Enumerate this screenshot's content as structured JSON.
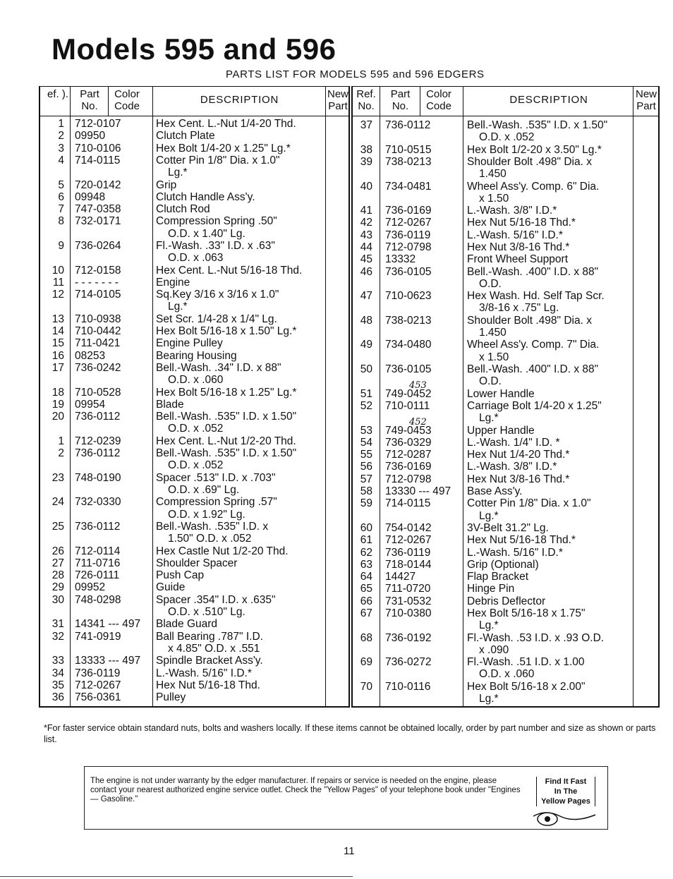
{
  "title": "Models 595 and 596",
  "subtitle": "PARTS LIST FOR MODELS 595 and 596 EDGERS",
  "headers": {
    "ref": "Ref. No.",
    "ref_left": "ef. ).",
    "part": "Part No.",
    "color": "Color Code",
    "description": "DESCRIPTION",
    "new_part": "New Part"
  },
  "left_table": [
    {
      "ref": "1",
      "part": "712-0107",
      "desc": [
        "Hex Cent. L.-Nut 1/4-20 Thd."
      ]
    },
    {
      "ref": "2",
      "part": "09950",
      "desc": [
        "Clutch Plate"
      ]
    },
    {
      "ref": "3",
      "part": "710-0106",
      "desc": [
        "Hex Bolt 1/4-20 x 1.25\" Lg.*"
      ]
    },
    {
      "ref": "4",
      "part": "714-0115",
      "desc": [
        "Cotter Pin 1/8\" Dia. x 1.0\"",
        "Lg.*"
      ]
    },
    {
      "ref": "5",
      "part": "720-0142",
      "desc": [
        "Grip"
      ]
    },
    {
      "ref": "6",
      "part": "09948",
      "desc": [
        "Clutch Handle Ass'y."
      ]
    },
    {
      "ref": "7",
      "part": "747-0358",
      "desc": [
        "Clutch Rod"
      ]
    },
    {
      "ref": "8",
      "part": "732-0171",
      "desc": [
        "Compression Spring .50\"",
        "O.D. x 1.40\" Lg."
      ]
    },
    {
      "ref": "9",
      "part": "736-0264",
      "desc": [
        "Fl.-Wash. .33\" I.D. x .63\"",
        "O.D. x .063"
      ]
    },
    {
      "ref": "10",
      "part": "712-0158",
      "desc": [
        "Hex Cent. L.-Nut 5/16-18 Thd."
      ]
    },
    {
      "ref": "11",
      "part": "- - - - - - -",
      "desc": [
        "Engine"
      ]
    },
    {
      "ref": "12",
      "part": "714-0105",
      "desc": [
        "Sq.Key 3/16 x 3/16 x 1.0\"",
        "Lg.*"
      ]
    },
    {
      "ref": "13",
      "part": "710-0938",
      "desc": [
        "Set Scr. 1/4-28 x 1/4\" Lg."
      ]
    },
    {
      "ref": "14",
      "part": "710-0442",
      "desc": [
        "Hex Bolt 5/16-18 x 1.50\" Lg.*"
      ]
    },
    {
      "ref": "15",
      "part": "711-0421",
      "desc": [
        "Engine Pulley"
      ]
    },
    {
      "ref": "16",
      "part": "08253",
      "desc": [
        "Bearing Housing"
      ]
    },
    {
      "ref": "17",
      "part": "736-0242",
      "desc": [
        "Bell.-Wash. .34\" I.D. x 88\"",
        "O.D. x .060"
      ]
    },
    {
      "ref": "18",
      "part": "710-0528",
      "desc": [
        "Hex Bolt 5/16-18 x 1.25\" Lg.*"
      ]
    },
    {
      "ref": "19",
      "part": "09954",
      "desc": [
        "Blade"
      ]
    },
    {
      "ref": "20",
      "part": "736-0112",
      "desc": [
        "Bell.-Wash. .535\" I.D. x 1.50\"",
        "O.D. x .052"
      ]
    },
    {
      "ref": "1",
      "part": "712-0239",
      "desc": [
        "Hex Cent. L.-Nut 1/2-20 Thd."
      ]
    },
    {
      "ref": "2",
      "part": "736-0112",
      "desc": [
        "Bell.-Wash. .535\" I.D. x 1.50\"",
        "O.D. x .052"
      ]
    },
    {
      "ref": "23",
      "part": "748-0190",
      "desc": [
        "Spacer .513\" I.D. x .703\"",
        "O.D. x .69\" Lg."
      ]
    },
    {
      "ref": "24",
      "part": "732-0330",
      "desc": [
        "Compression Spring .57\"",
        "O.D. x 1.92\" Lg."
      ]
    },
    {
      "ref": "25",
      "part": "736-0112",
      "desc": [
        "Bell.-Wash. .535\" I.D. x",
        "1.50\" O.D. x .052"
      ]
    },
    {
      "ref": "26",
      "part": "712-0114",
      "desc": [
        "Hex Castle Nut 1/2-20 Thd."
      ]
    },
    {
      "ref": "27",
      "part": "711-0716",
      "desc": [
        "Shoulder Spacer"
      ]
    },
    {
      "ref": "28",
      "part": "726-0111",
      "desc": [
        "Push Cap"
      ]
    },
    {
      "ref": "29",
      "part": "09952",
      "desc": [
        "Guide"
      ]
    },
    {
      "ref": "30",
      "part": "748-0298",
      "desc": [
        "Spacer .354\" I.D. x .635\"",
        "O.D. x .510\" Lg."
      ]
    },
    {
      "ref": "31",
      "part": "14341 --- 497",
      "desc": [
        "Blade Guard"
      ]
    },
    {
      "ref": "32",
      "part": "741-0919",
      "desc": [
        "Ball Bearing .787\" I.D.",
        "x 4.85\" O.D. x .551"
      ]
    },
    {
      "ref": "33",
      "part": "13333 --- 497",
      "desc": [
        "Spindle Bracket Ass'y."
      ]
    },
    {
      "ref": "34",
      "part": "736-0119",
      "desc": [
        "L.-Wash. 5/16\" I.D.*"
      ]
    },
    {
      "ref": "35",
      "part": "712-0267",
      "desc": [
        "Hex Nut 5/16-18 Thd."
      ]
    },
    {
      "ref": "36",
      "part": "756-0361",
      "desc": [
        "Pulley"
      ]
    }
  ],
  "right_table": [
    {
      "ref": "37",
      "part": "736-0112",
      "desc": [
        "Bell.-Wash. .535\" I.D. x 1.50\"",
        "O.D. x .052"
      ]
    },
    {
      "ref": "38",
      "part": "710-0515",
      "desc": [
        "Hex Bolt 1/2-20 x 3.50\" Lg.*"
      ]
    },
    {
      "ref": "39",
      "part": "738-0213",
      "desc": [
        "Shoulder Bolt .498\" Dia. x",
        "1.450"
      ]
    },
    {
      "ref": "40",
      "part": "734-0481",
      "desc": [
        "Wheel Ass'y. Comp. 6\" Dia.",
        "x 1.50"
      ]
    },
    {
      "ref": "41",
      "part": "736-0169",
      "desc": [
        "L.-Wash. 3/8\" I.D.*"
      ]
    },
    {
      "ref": "42",
      "part": "712-0267",
      "desc": [
        "Hex Nut 5/16-18 Thd.*"
      ]
    },
    {
      "ref": "43",
      "part": "736-0119",
      "desc": [
        "L.-Wash. 5/16\" I.D.*"
      ]
    },
    {
      "ref": "44",
      "part": "712-0798",
      "desc": [
        "Hex Nut 3/8-16 Thd.*"
      ]
    },
    {
      "ref": "45",
      "part": "13332",
      "desc": [
        "Front Wheel Support"
      ]
    },
    {
      "ref": "46",
      "part": "736-0105",
      "desc": [
        "Bell.-Wash. .400\" I.D. x 88\"",
        "O.D."
      ]
    },
    {
      "ref": "47",
      "part": "710-0623",
      "desc": [
        "Hex Wash. Hd. Self Tap Scr.",
        "3/8-16 x .75\" Lg."
      ]
    },
    {
      "ref": "48",
      "part": "738-0213",
      "desc": [
        "Shoulder Bolt .498\" Dia. x",
        "1.450"
      ]
    },
    {
      "ref": "49",
      "part": "734-0480",
      "desc": [
        "Wheel Ass'y. Comp. 7\" Dia.",
        "x 1.50"
      ]
    },
    {
      "ref": "50",
      "part": "736-0105",
      "desc": [
        "Bell.-Wash. .400\" I.D. x 88\"",
        "O.D."
      ]
    },
    {
      "ref": "51",
      "part": "749-0452",
      "handwritten": "453",
      "desc": [
        "Lower Handle"
      ]
    },
    {
      "ref": "52",
      "part": "710-0111",
      "desc": [
        "Carriage Bolt 1/4-20 x 1.25\"",
        "Lg.*"
      ]
    },
    {
      "ref": "53",
      "part": "749-0453",
      "handwritten": "452",
      "desc": [
        "Upper Handle"
      ]
    },
    {
      "ref": "54",
      "part": "736-0329",
      "desc": [
        "L.-Wash. 1/4\" I.D. *"
      ]
    },
    {
      "ref": "55",
      "part": "712-0287",
      "desc": [
        "Hex Nut 1/4-20 Thd.*"
      ]
    },
    {
      "ref": "56",
      "part": "736-0169",
      "desc": [
        "L.-Wash. 3/8\" I.D.*"
      ]
    },
    {
      "ref": "57",
      "part": "712-0798",
      "desc": [
        "Hex Nut 3/8-16 Thd.*"
      ]
    },
    {
      "ref": "58",
      "part": "13330 --- 497",
      "desc": [
        "Base Ass'y."
      ]
    },
    {
      "ref": "59",
      "part": "714-0115",
      "desc": [
        "Cotter Pin 1/8\" Dia. x 1.0\"",
        "Lg.*"
      ]
    },
    {
      "ref": "60",
      "part": "754-0142",
      "desc": [
        "3V-Belt 31.2\" Lg."
      ]
    },
    {
      "ref": "61",
      "part": "712-0267",
      "desc": [
        "Hex Nut 5/16-18 Thd.*"
      ]
    },
    {
      "ref": "62",
      "part": "736-0119",
      "desc": [
        "L.-Wash. 5/16\" I.D.*"
      ]
    },
    {
      "ref": "63",
      "part": "718-0144",
      "desc": [
        "Grip (Optional)"
      ]
    },
    {
      "ref": "64",
      "part": "14427",
      "desc": [
        "Flap Bracket"
      ]
    },
    {
      "ref": "65",
      "part": "711-0720",
      "desc": [
        "Hinge Pin"
      ]
    },
    {
      "ref": "66",
      "part": "731-0532",
      "desc": [
        "Debris Deflector"
      ]
    },
    {
      "ref": "67",
      "part": "710-0380",
      "desc": [
        "Hex Bolt 5/16-18 x 1.75\"",
        "Lg.*"
      ]
    },
    {
      "ref": "68",
      "part": "736-0192",
      "desc": [
        "Fl.-Wash. .53 I.D. x .93 O.D.",
        "x .090"
      ]
    },
    {
      "ref": "69",
      "part": "736-0272",
      "desc": [
        "Fl.-Wash. .51 I.D. x 1.00",
        "O.D. x .060"
      ]
    },
    {
      "ref": "70",
      "part": "710-0116",
      "desc": [
        "Hex Bolt 5/16-18 x 2.00\"",
        "Lg.*"
      ]
    }
  ],
  "footnote": "*For faster service obtain standard nuts, bolts and washers locally. If these items cannot be obtained locally, order by part number and size as shown or parts list.",
  "engine_notice": "The engine is not under warranty by the edger manufacturer. If repairs or service is needed on the engine, please contact your nearest authorized engine service outlet. Check the \"Yellow Pages\" of your telephone book under \"Engines — Gasoline.\"",
  "yellow_pages_badge": [
    "Find It Fast",
    "In The",
    "Yellow Pages"
  ],
  "page_number": "11"
}
